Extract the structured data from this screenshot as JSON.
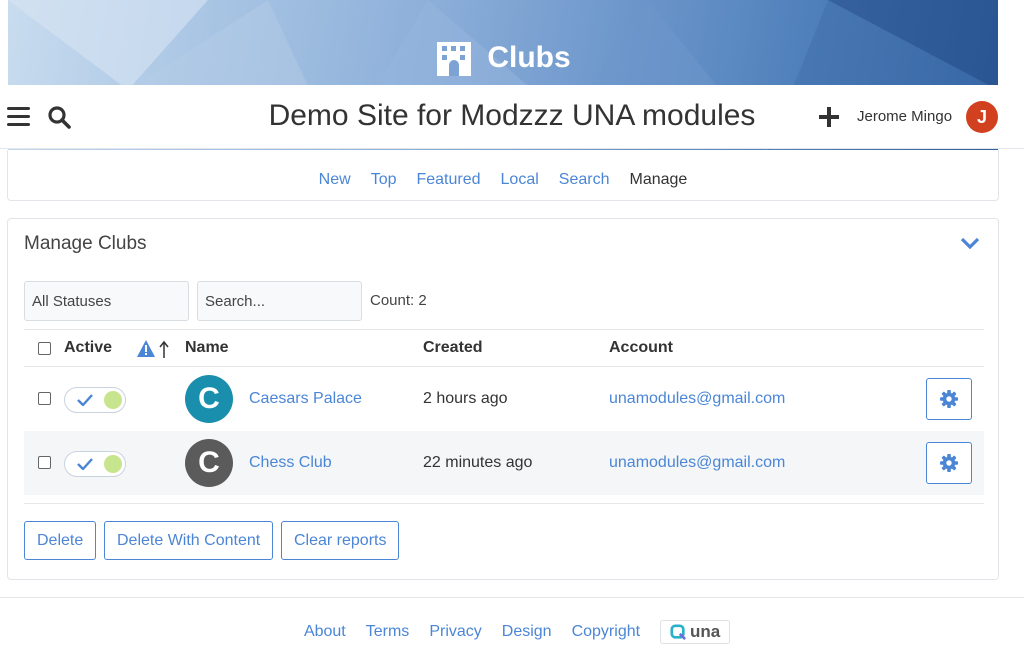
{
  "cover": {
    "title": "Clubs"
  },
  "header": {
    "site_title": "Demo Site for Modzzz UNA modules",
    "user_name": "Jerome Mingo",
    "user_initial": "J"
  },
  "submenu": {
    "items": [
      "New",
      "Top",
      "Featured",
      "Local",
      "Search",
      "Manage"
    ],
    "active": "Manage"
  },
  "manage": {
    "title": "Manage Clubs",
    "status_filter": "All Statuses",
    "search_placeholder": "Search...",
    "count_label": "Count: 2",
    "columns": {
      "active": "Active",
      "name": "Name",
      "created": "Created",
      "account": "Account"
    },
    "rows": [
      {
        "initial": "C",
        "name": "Caesars Palace",
        "created": "2 hours ago",
        "account": "unamodules@gmail.com",
        "thumb_color": "#1a8fad",
        "active": true
      },
      {
        "initial": "C",
        "name": "Chess Club",
        "created": "22 minutes ago",
        "account": "unamodules@gmail.com",
        "thumb_color": "#5b5b5b",
        "active": true
      }
    ],
    "buttons": {
      "delete": "Delete",
      "delete_with_content": "Delete With Content",
      "clear_reports": "Clear reports"
    }
  },
  "footer": {
    "links": [
      "About",
      "Terms",
      "Privacy",
      "Design",
      "Copyright"
    ],
    "logo_text": "una"
  },
  "colors": {
    "link": "#4b86d6",
    "avatar": "#d2411f",
    "toggle_knob": "#c7e58e"
  }
}
